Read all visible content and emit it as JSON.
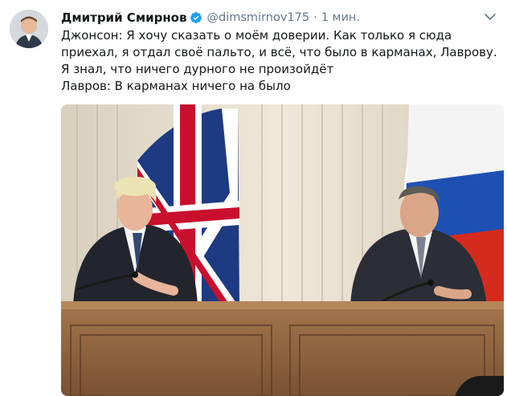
{
  "user": {
    "name": "Дмитрий Смирнов",
    "handle": "@dimsmirnov175",
    "separator": "·",
    "time": "1 мин.",
    "verified": true
  },
  "tweet": {
    "line1": "Джонсон: Я хочу сказать о моём доверии. Как только я сюда приехал, я отдал своё пальто, и всё, что было в карманах, Лаврову. Я знал, что ничего дурного не произойдёт",
    "line2": "Лавров: В карманах ничего на было"
  },
  "icons": {
    "verified": "verified-badge-icon",
    "caret": "chevron-down-icon"
  },
  "colors": {
    "text": "#14171a",
    "secondary": "#657786",
    "verified": "#1da1f2"
  }
}
